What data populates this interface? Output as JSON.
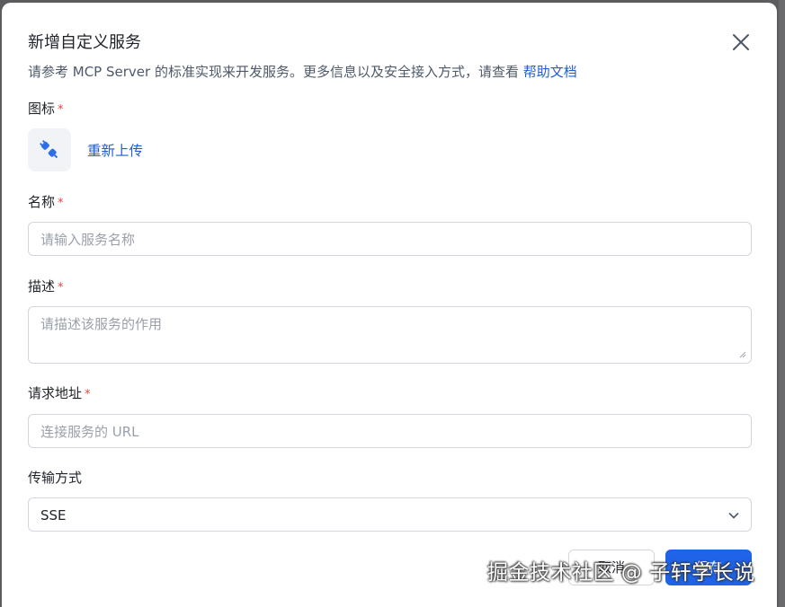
{
  "dialog": {
    "title": "新增自定义服务",
    "subtitle_text": "请参考 MCP Server 的标准实现来开发服务。更多信息以及安全接入方式，请查看",
    "subtitle_link": "帮助文档"
  },
  "form": {
    "icon": {
      "label": "图标",
      "required_mark": "*",
      "icon_name": "plug-icon",
      "reupload_label": "重新上传"
    },
    "name": {
      "label": "名称",
      "required_mark": "*",
      "value": "",
      "placeholder": "请输入服务名称"
    },
    "description": {
      "label": "描述",
      "required_mark": "*",
      "value": "",
      "placeholder": "请描述该服务的作用"
    },
    "url": {
      "label": "请求地址",
      "required_mark": "*",
      "value": "",
      "placeholder": "连接服务的 URL"
    },
    "transport": {
      "label": "传输方式",
      "selected": "SSE"
    }
  },
  "footer": {
    "cancel_label": "取消",
    "save_label": "保存"
  },
  "watermark": "掘金技术社区 @ 子轩学长说",
  "colors": {
    "accent": "#1f63e8",
    "link": "#1e5fd0",
    "required": "#e8473a"
  }
}
